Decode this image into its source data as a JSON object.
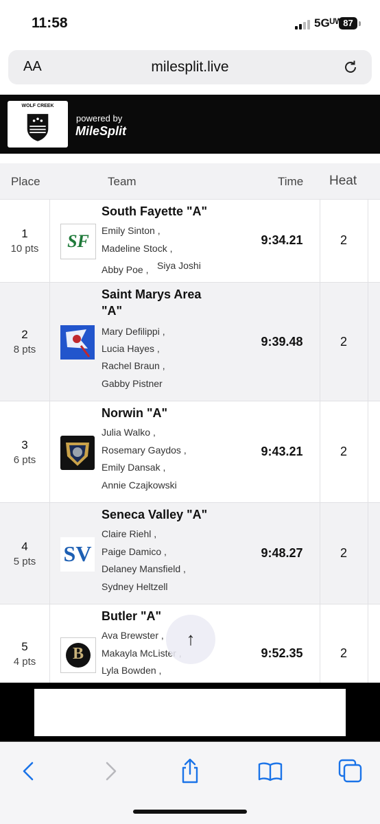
{
  "status": {
    "time": "11:58",
    "network": "5Gᵁᵂ",
    "battery": "87"
  },
  "browser": {
    "aa_label": "AA",
    "url": "milesplit.live"
  },
  "banner": {
    "logo_text": "WOLF CREEK",
    "powered_by": "powered by",
    "brand": "MileSplit"
  },
  "table": {
    "headers": {
      "place": "Place",
      "team": "Team",
      "time": "Time",
      "heat": "Heat"
    },
    "rows": [
      {
        "place": "1",
        "points": "10 pts",
        "team": "South Fayette \"A\"",
        "runners": [
          "Emily Sinton ,",
          "Madeline Stock ,",
          "Abby Poe ,",
          "Siya Joshi"
        ],
        "time": "9:34.21",
        "heat": "2",
        "badge_text": "SF"
      },
      {
        "place": "2",
        "points": "8 pts",
        "team_line1": "Saint Marys Area",
        "team_line2": "\"A\"",
        "runners": [
          "Mary Defilippi ,",
          "Lucia Hayes ,",
          "Rachel Braun ,",
          "Gabby Pistner"
        ],
        "time": "9:39.48",
        "heat": "2"
      },
      {
        "place": "3",
        "points": "6 pts",
        "team": "Norwin \"A\"",
        "runners": [
          "Julia Walko ,",
          "Rosemary Gaydos ,",
          "Emily Dansak ,",
          "Annie Czajkowski"
        ],
        "time": "9:43.21",
        "heat": "2"
      },
      {
        "place": "4",
        "points": "5 pts",
        "team": "Seneca Valley \"A\"",
        "runners": [
          "Claire Riehl ,",
          "Paige Damico ,",
          "Delaney Mansfield ,",
          "Sydney Heltzell"
        ],
        "time": "9:48.27",
        "heat": "2",
        "badge_text": "SV"
      },
      {
        "place": "5",
        "points": "4 pts",
        "team": "Butler \"A\"",
        "runners": [
          "Ava Brewster ,",
          "Makayla McLister ,",
          "Lyla Bowden ,"
        ],
        "time": "9:52.35",
        "heat": "2",
        "badge_text": "B"
      }
    ]
  },
  "scroll_top": {
    "arrow": "↑"
  },
  "colors": {
    "accent": "#1a73e8",
    "banner_bg": "#0a0a0a",
    "row_alt": "#f2f2f4"
  },
  "icons": [
    "signal-icon",
    "battery-icon",
    "reload-icon",
    "back-icon",
    "forward-icon",
    "share-icon",
    "bookmarks-icon",
    "tabs-icon"
  ]
}
